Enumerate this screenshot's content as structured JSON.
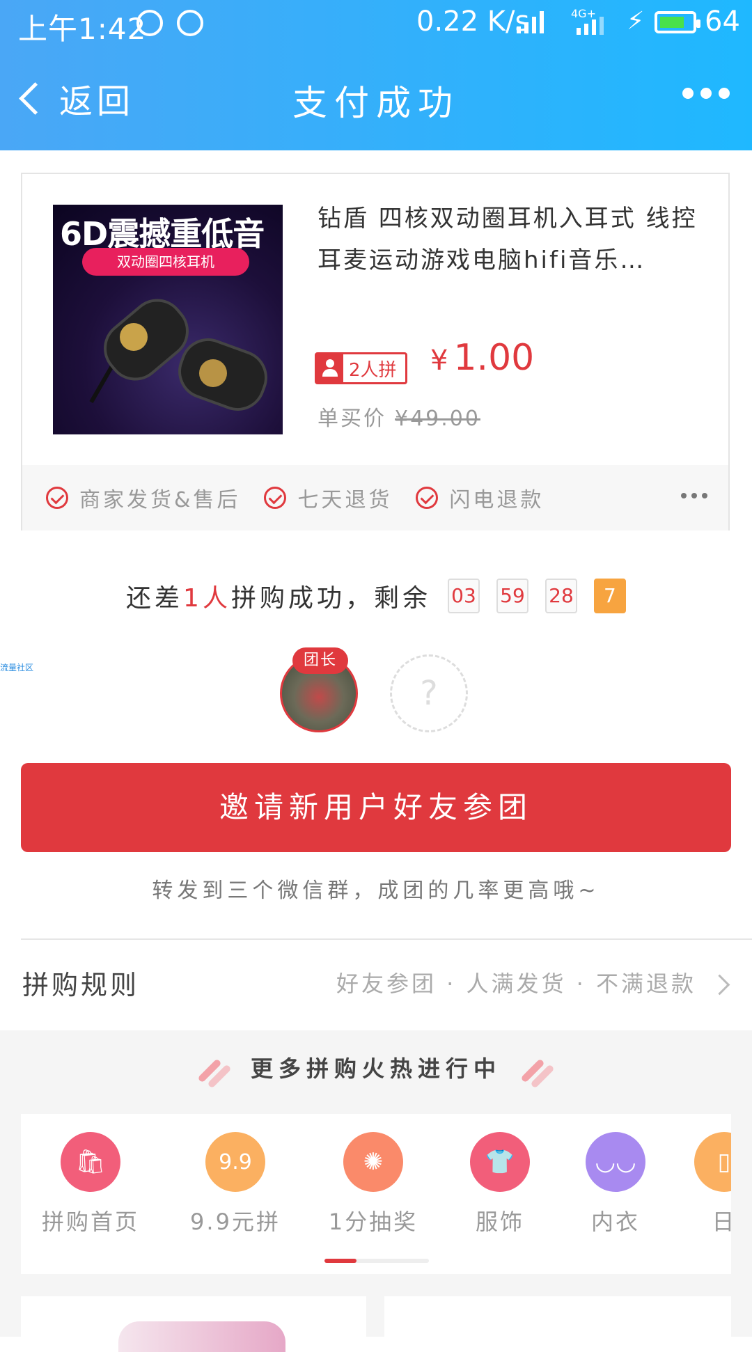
{
  "status_bar": {
    "time": "上午1:42",
    "net_speed": "0.22 K/s",
    "network": "4G+",
    "battery": "64"
  },
  "nav": {
    "back": "返回",
    "title": "支付成功"
  },
  "product": {
    "image_text_main": "6D震撼重低音",
    "image_text_sub": "双动圈四核耳机",
    "title": "钻盾 四核双动圈耳机入耳式 线控耳麦运动游戏电脑hifi音乐…",
    "group_badge": "2人拼",
    "currency": "¥",
    "price": "1.00",
    "single_label": "单买价",
    "single_price": "¥49.00",
    "guarantees": [
      "商家发货&售后",
      "七天退货",
      "闪电退款"
    ]
  },
  "countdown": {
    "prefix": "还差",
    "count": "1人",
    "suffix": "拼购成功，剩余",
    "hours": "03",
    "minutes": "59",
    "seconds": "28",
    "tenths": "7"
  },
  "side_label": "流量社区",
  "members": {
    "leader_label": "团长",
    "empty_mark": "?"
  },
  "invite_button": "邀请新用户好友参团",
  "hint": "转发到三个微信群，成团的几率更高哦~",
  "rules": {
    "label": "拼购规则",
    "desc": "好友参团 · 人满发货 · 不满退款"
  },
  "more": {
    "title": "更多拼购火热进行中",
    "categories": [
      {
        "label": "拼购首页",
        "icon": "shopping-bag-icon",
        "color": "#f25e7a"
      },
      {
        "label": "9.9元拼",
        "icon": "nine-nine-icon",
        "color": "#fbb061"
      },
      {
        "label": "1分抽奖",
        "icon": "wheel-icon",
        "color": "#fa8a6a"
      },
      {
        "label": "服饰",
        "icon": "shirt-icon",
        "color": "#f25e7a"
      },
      {
        "label": "内衣",
        "icon": "bra-icon",
        "color": "#a88af0"
      },
      {
        "label": "日",
        "icon": "daily-icon",
        "color": "#fbb061"
      }
    ]
  },
  "colors": {
    "accent": "#e0393e",
    "header": "#26b5fd"
  }
}
